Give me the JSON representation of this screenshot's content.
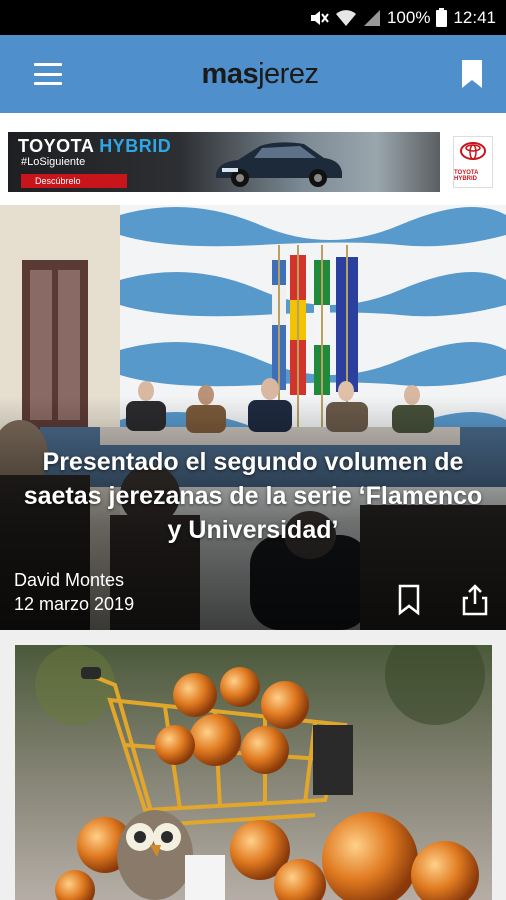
{
  "status_bar": {
    "battery": "100%",
    "time": "12:41",
    "icons": [
      "mute-icon",
      "wifi-icon",
      "signal-icon",
      "battery-icon"
    ]
  },
  "app_bar": {
    "logo_prefix": "mas",
    "logo_suffix": "jerez",
    "icons": [
      "menu-icon",
      "bookmark-icon"
    ],
    "color": "#4f8fcc"
  },
  "ad": {
    "brand": "TOYOTA",
    "brand_accent": "HYBRID",
    "tagline": "#LoSiguiente",
    "cta": "Descúbrelo",
    "logo_text": "TOYOTA",
    "logo_sub": "HYBRID"
  },
  "hero": {
    "title": "Presentado el segundo volumen de saetas jerezanas de la serie ‘Flamenco y Universidad’",
    "author": "David Montes",
    "date": "12 marzo 2019",
    "icons": [
      "bookmark-outline-icon",
      "share-icon"
    ]
  },
  "card2": {
    "image": "christmas-ornaments-shopping-cart"
  }
}
